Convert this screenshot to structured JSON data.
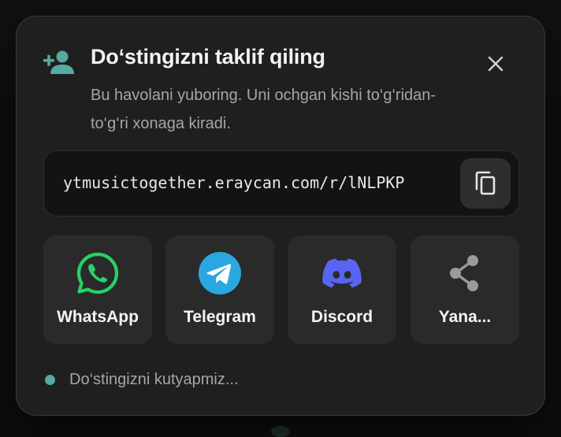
{
  "modal": {
    "title": "Do‘stingizni taklif qiling",
    "subtitle": "Bu havolani yuboring. Uni ochgan kishi to‘g‘ridan-to‘g‘ri xonaga kiradi.",
    "header_icon": "add-person-icon",
    "close_icon": "close-icon"
  },
  "invite_link": {
    "url": "ytmusictogether.eraycan.com/r/lNLPKP",
    "copy_icon": "copy-icon"
  },
  "share_options": [
    {
      "label": "WhatsApp",
      "icon": "whatsapp-icon",
      "color": "#25d366"
    },
    {
      "label": "Telegram",
      "icon": "telegram-icon",
      "color": "#2aa7e0"
    },
    {
      "label": "Discord",
      "icon": "discord-icon",
      "color": "#5865f2"
    },
    {
      "label": "Yana...",
      "icon": "share-icon",
      "color": "#9a9a9a"
    }
  ],
  "status": {
    "text": "Do‘stingizni kutyapmiz...",
    "dot_color": "#56aaa0"
  },
  "colors": {
    "accent": "#56aaa0",
    "surface": "#1f1f1f",
    "card": "#2a2a2a"
  }
}
